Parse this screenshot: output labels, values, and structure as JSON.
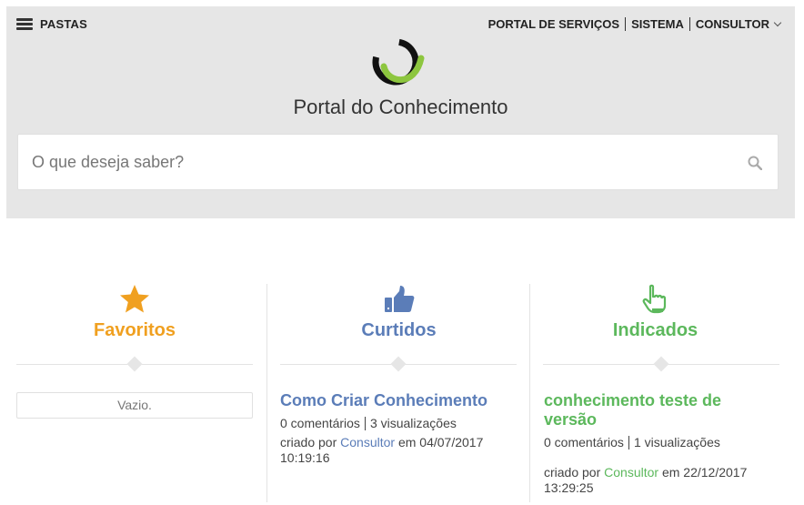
{
  "header": {
    "menu_label": "PASTAS",
    "nav": [
      "PORTAL DE SERVIÇOS",
      "SISTEMA",
      "CONSULTOR"
    ],
    "title": "Portal do Conhecimento"
  },
  "search": {
    "placeholder": "O que deseja saber?",
    "value": ""
  },
  "colors": {
    "orange": "#f0a020",
    "blue": "#5b7db8",
    "green": "#5cb85c",
    "logo_green": "#8dc63f"
  },
  "sections": {
    "favoritos": {
      "title": "Favoritos",
      "empty_text": "Vazio.",
      "icon": "star-icon"
    },
    "curtidos": {
      "title": "Curtidos",
      "icon": "thumbs-up-icon",
      "item": {
        "title": "Como Criar Conhecimento",
        "comments": "0 comentários",
        "views": "3 visualizações",
        "created_prefix": "criado por",
        "author": "Consultor",
        "date_prefix": "em 04/07/2017",
        "time": "10:19:16"
      }
    },
    "indicados": {
      "title": "Indicados",
      "icon": "pointing-hand-icon",
      "item": {
        "title": "conhecimento teste de versão",
        "comments": "0 comentários",
        "views": "1 visualizações",
        "created_prefix": "criado por",
        "author": "Consultor",
        "date_prefix": "em 22/12/2017",
        "time": "13:29:25"
      }
    }
  }
}
